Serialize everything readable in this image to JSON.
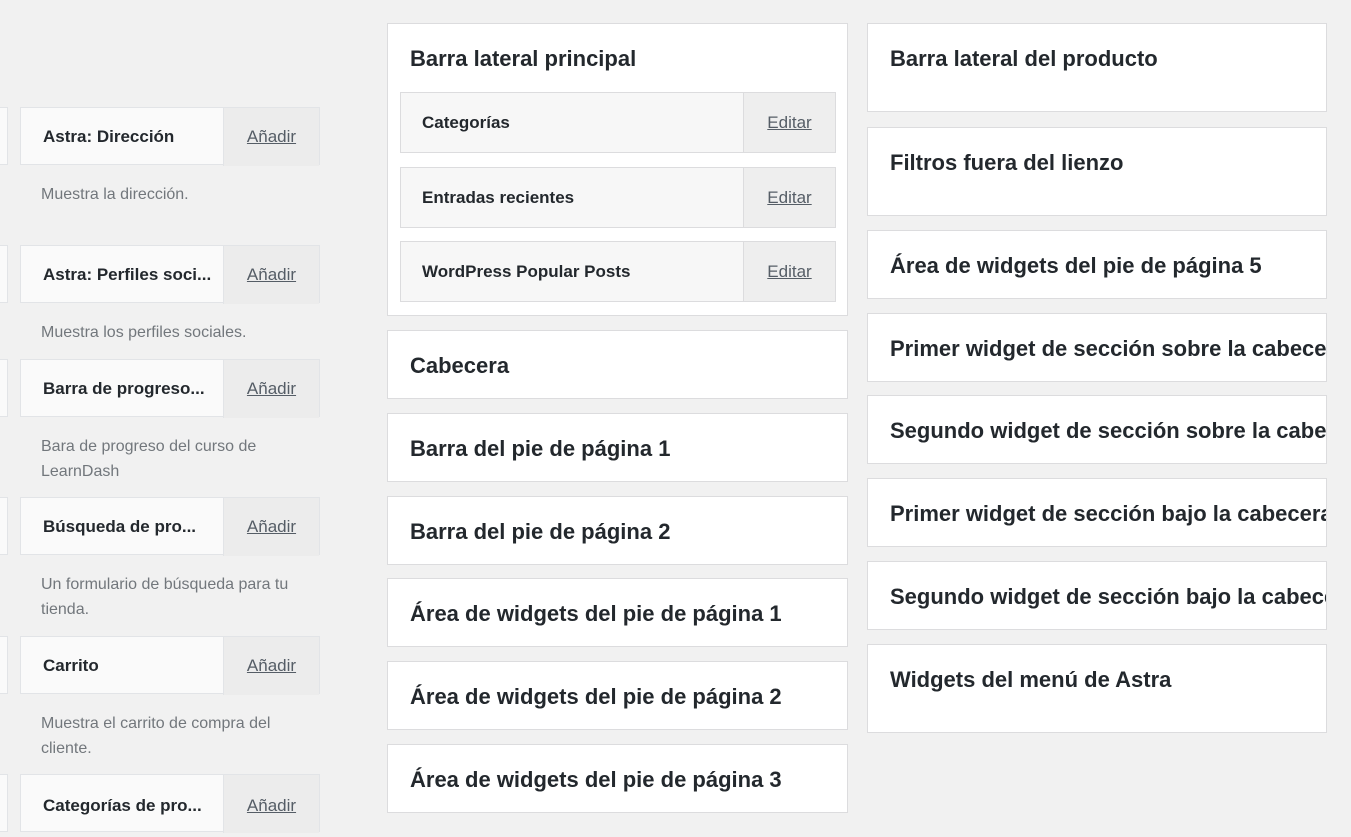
{
  "available_widgets": [
    {
      "title": "Astra: Dirección",
      "add_label": "Añadir",
      "description": "Muestra la dirección."
    },
    {
      "title": "Astra: Perfiles soci...",
      "add_label": "Añadir",
      "description": "Muestra los perfiles sociales."
    },
    {
      "title": "Barra de progreso...",
      "add_label": "Añadir",
      "description": "Bara de progreso del curso de LearnDash"
    },
    {
      "title": "Búsqueda de pro...",
      "add_label": "Añadir",
      "description": "Un formulario de búsqueda para tu tienda."
    },
    {
      "title": "Carrito",
      "add_label": "Añadir",
      "description": "Muestra el carrito de compra del cliente."
    },
    {
      "title": "Categorías de pro...",
      "add_label": "Añadir",
      "description": ""
    }
  ],
  "main_sidebar": {
    "title": "Barra lateral principal",
    "widgets": [
      {
        "title": "Categorías",
        "edit_label": "Editar"
      },
      {
        "title": "Entradas recientes",
        "edit_label": "Editar"
      },
      {
        "title": "WordPress Popular Posts",
        "edit_label": "Editar"
      }
    ]
  },
  "middle_sidebars": [
    {
      "title": "Cabecera"
    },
    {
      "title": "Barra del pie de página 1"
    },
    {
      "title": "Barra del pie de página 2"
    },
    {
      "title": "Área de widgets del pie de página 1"
    },
    {
      "title": "Área de widgets del pie de página 2"
    },
    {
      "title": "Área de widgets del pie de página 3"
    }
  ],
  "right_sidebars": [
    {
      "title": "Barra lateral del producto"
    },
    {
      "title": "Filtros fuera del lienzo"
    },
    {
      "title": "Área de widgets del pie de página 5"
    },
    {
      "title": "Primer widget de sección sobre la cabecera"
    },
    {
      "title": "Segundo widget de sección sobre la cabecera"
    },
    {
      "title": "Primer widget de sección bajo la cabecera"
    },
    {
      "title": "Segundo widget de sección bajo la cabecera"
    },
    {
      "title": "Widgets del menú de Astra"
    }
  ]
}
